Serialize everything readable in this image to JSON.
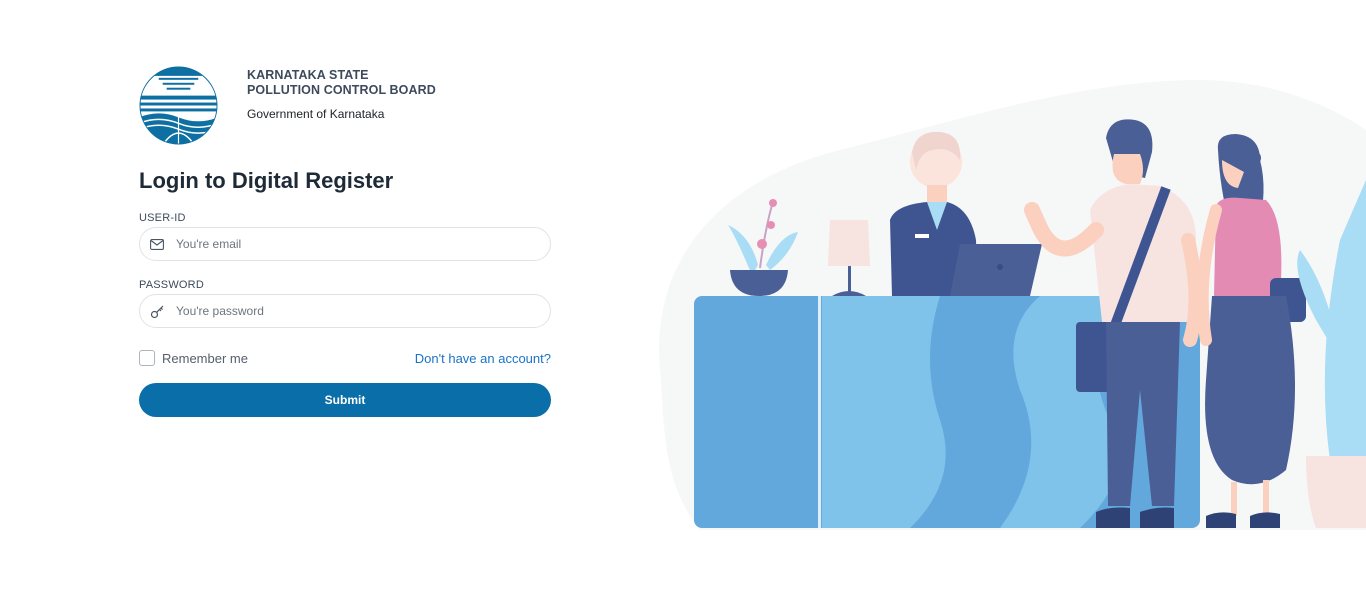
{
  "brand": {
    "org_line1": "KARNATAKA STATE",
    "org_line2": "POLLUTION CONTROL BOARD",
    "subtitle": "Government of Karnataka",
    "logo_icon": "kspcb-logo-icon"
  },
  "login": {
    "title": "Login to Digital Register",
    "user_label": "USER-ID",
    "user_placeholder": "You're email",
    "user_value": "",
    "user_icon": "envelope-icon",
    "pass_label": "PASSWORD",
    "pass_placeholder": "You're password",
    "pass_value": "",
    "pass_icon": "key-icon",
    "remember_label": "Remember me",
    "remember_checked": false,
    "signup_link": "Don't have an account?",
    "submit_label": "Submit"
  },
  "colors": {
    "primary": "#0a6fa8",
    "link": "#1a73c8",
    "heading": "#1f2a37"
  },
  "illustration": {
    "name": "reception-desk-illustration"
  }
}
